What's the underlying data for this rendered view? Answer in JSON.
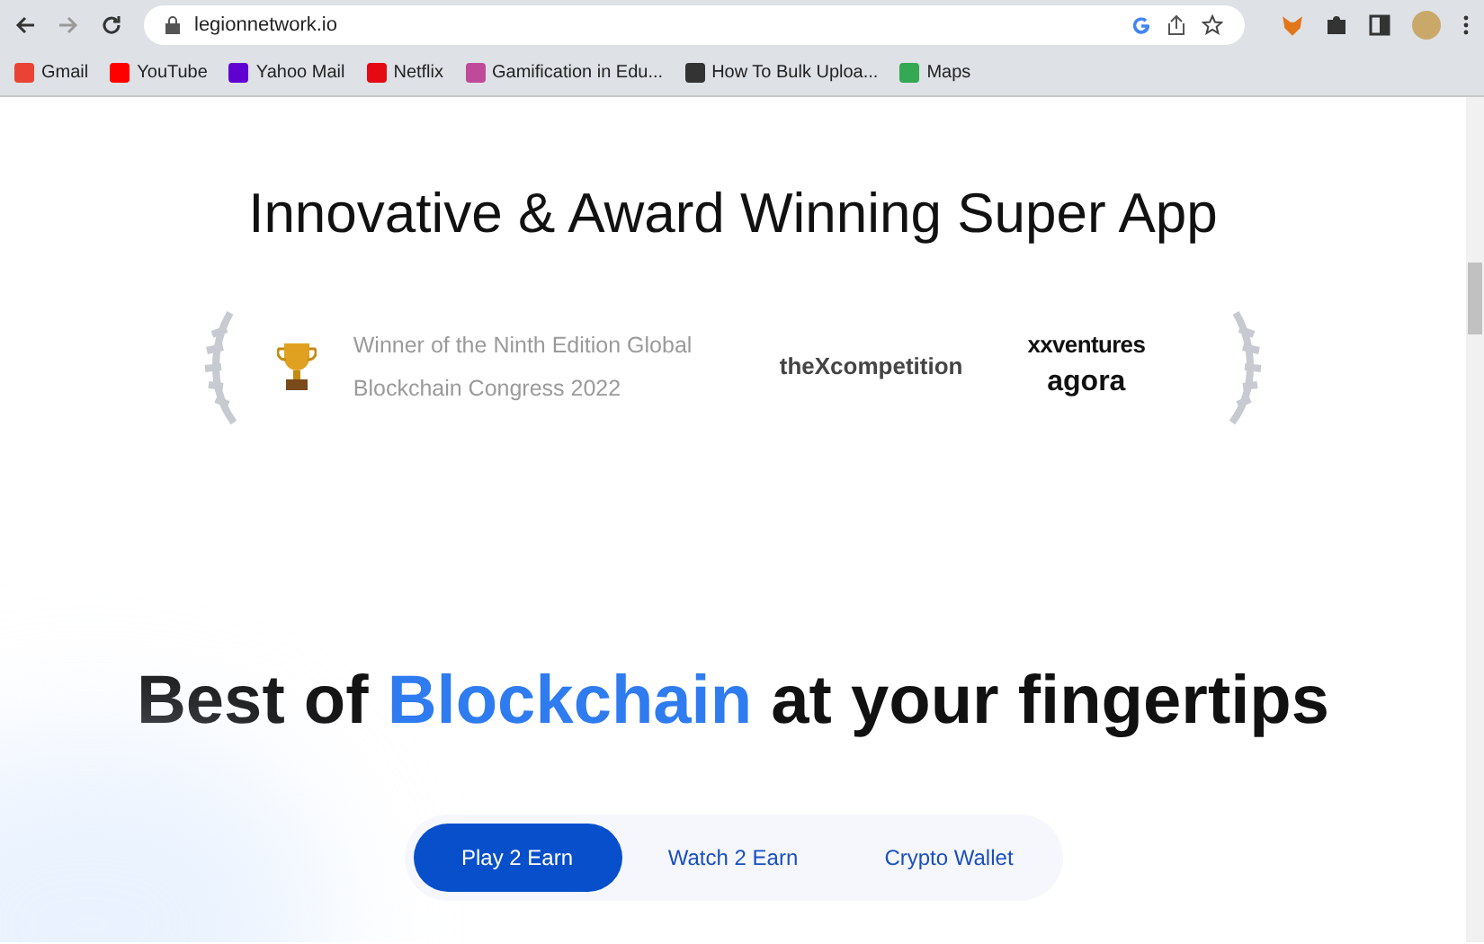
{
  "browser": {
    "url": "legionnetwork.io",
    "bookmarks": [
      {
        "label": "Gmail"
      },
      {
        "label": "YouTube"
      },
      {
        "label": "Yahoo Mail"
      },
      {
        "label": "Netflix"
      },
      {
        "label": "Gamification in Edu..."
      },
      {
        "label": "How To Bulk Uploa..."
      },
      {
        "label": "Maps"
      }
    ]
  },
  "page": {
    "title": "Innovative & Award Winning Super App",
    "award": {
      "text": "Winner of the Ninth Edition Global Blockchain Congress 2022",
      "logos": [
        "theXcompetition",
        "xxventures",
        "agora"
      ]
    },
    "heading": {
      "before": "Best of ",
      "highlight": "Blockchain",
      "after": " at your fingertips"
    },
    "tabs": [
      {
        "label": "Play 2 Earn",
        "selected": true
      },
      {
        "label": "Watch 2 Earn",
        "selected": false
      },
      {
        "label": "Crypto Wallet",
        "selected": false
      }
    ]
  }
}
